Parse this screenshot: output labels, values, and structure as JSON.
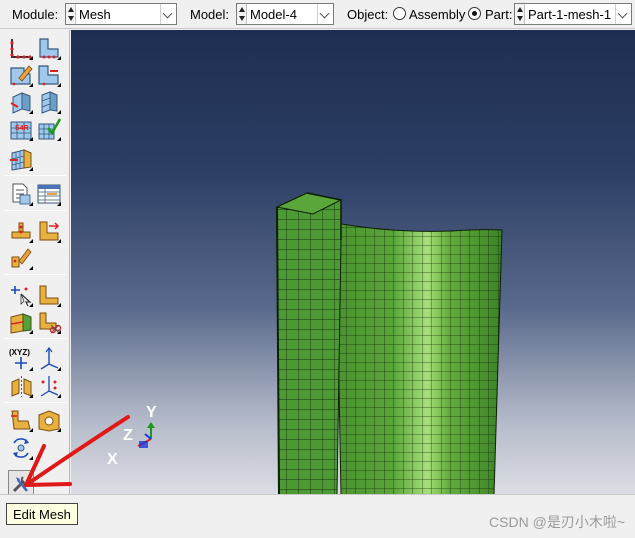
{
  "context_bar": {
    "module_label": "Module:",
    "module_value": "Mesh",
    "model_label": "Model:",
    "model_value": "Model-4",
    "object_label": "Object:",
    "assembly_label": "Assembly",
    "part_label": "Part:",
    "part_value": "Part-1-mesh-1",
    "object_selected": "Part"
  },
  "toolbox": {
    "xyz_text": "(XYZ)"
  },
  "triad": {
    "x_label": "X",
    "y_label": "Y",
    "z_label": "Z"
  },
  "tooltip": {
    "text": "Edit Mesh"
  },
  "watermark": "CSDN @是刃小木啦~",
  "colors": {
    "mesh_green": "#4d9a34",
    "mesh_highlight": "#a6e07a",
    "annotation_red": "#e01818",
    "viewport_top": "#1e2e50",
    "viewport_bottom": "#dcdde4"
  }
}
